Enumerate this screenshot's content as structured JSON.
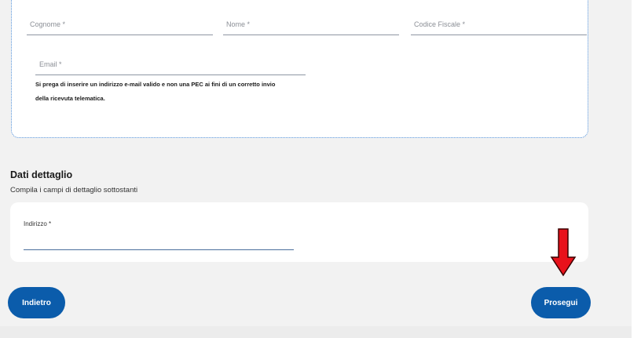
{
  "personal": {
    "cognome_placeholder": "Cognome *",
    "nome_placeholder": "Nome *",
    "codice_fiscale_placeholder": "Codice Fiscale *",
    "email_placeholder": "Email *",
    "email_hint_line1": "Si prega di inserire un indirizzo e-mail valido e non una PEC ai fini di un corretto invio",
    "email_hint_line2": "della ricevuta telematica."
  },
  "detail": {
    "title": "Dati dettaglio",
    "subtitle": "Compila i campi di dettaglio sottostanti",
    "indirizzo_label": "Indirizzo *",
    "indirizzo_value": ""
  },
  "actions": {
    "back_label": "Indietro",
    "next_label": "Prosegui"
  },
  "annotation": {
    "arrow_icon": "red-down-arrow-icon",
    "arrow_color": "#e8121b"
  },
  "colors": {
    "primary_button": "#0b5cab",
    "card_border": "#4f8ed8",
    "page_background": "#f2f2f2"
  }
}
